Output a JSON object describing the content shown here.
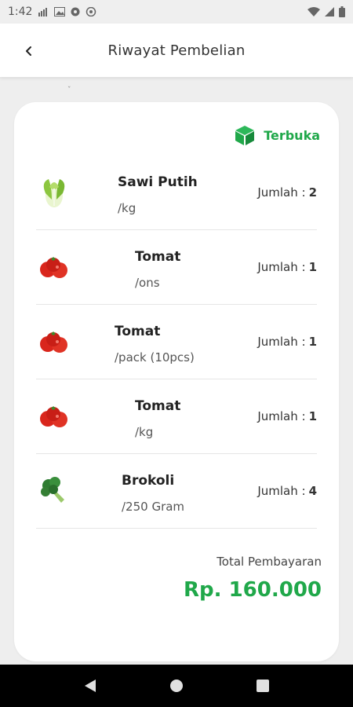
{
  "status_bar": {
    "time": "1:42"
  },
  "app_bar": {
    "title": "Riwayat Pembelian"
  },
  "misc": {
    "mark": "ˇ"
  },
  "order": {
    "status": "Terbuka",
    "status_color": "#20a84a",
    "items": [
      {
        "name": "Sawi Putih",
        "unit": "/kg",
        "qty_label": "Jumlah :",
        "qty": "2",
        "image": "cabbage"
      },
      {
        "name": "Tomat",
        "unit": "/ons",
        "qty_label": "Jumlah :",
        "qty": "1",
        "image": "tomato"
      },
      {
        "name": "Tomat",
        "unit": "/pack (10pcs)",
        "qty_label": "Jumlah :",
        "qty": "1",
        "image": "tomato"
      },
      {
        "name": "Tomat",
        "unit": "/kg",
        "qty_label": "Jumlah :",
        "qty": "1",
        "image": "tomato"
      },
      {
        "name": "Brokoli",
        "unit": "/250 Gram",
        "qty_label": "Jumlah :",
        "qty": "4",
        "image": "broccoli"
      }
    ],
    "total_label": "Total Pembayaran",
    "total_amount": "Rp. 160.000"
  },
  "icons": {
    "back": "back-arrow-icon",
    "status": "box-icon",
    "nav": [
      "back-triangle-icon",
      "home-circle-icon",
      "recents-square-icon"
    ]
  }
}
